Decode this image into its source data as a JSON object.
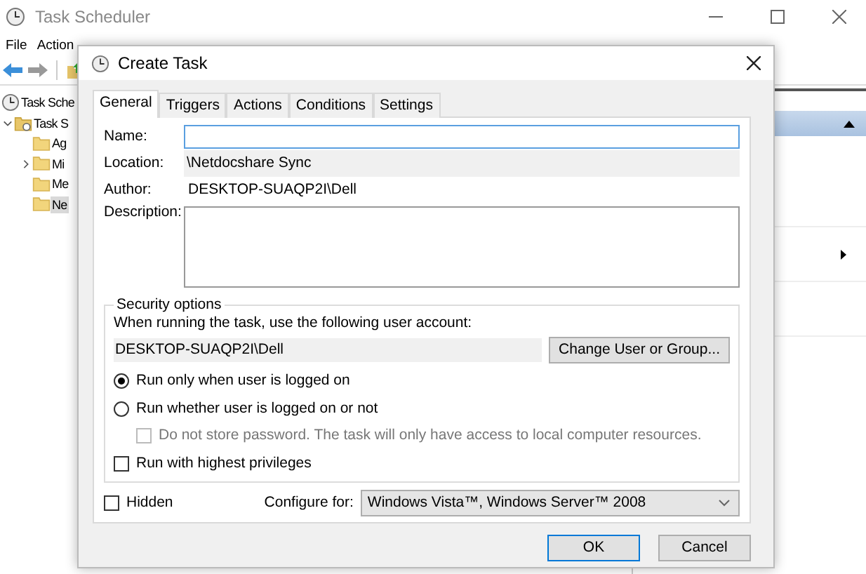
{
  "main_window": {
    "title": "Task Scheduler",
    "menu": [
      "File",
      "Action"
    ],
    "tree": [
      {
        "label": "Task Sche",
        "kind": "clock",
        "has_children": false,
        "selected": false,
        "children": [
          {
            "label": "Task S",
            "kind": "library",
            "has_children": true,
            "selected": false,
            "children": [
              {
                "label": "Ag",
                "kind": "folder",
                "has_children": false,
                "selected": false
              },
              {
                "label": "Mi",
                "kind": "folder",
                "has_children": true,
                "selected": false
              },
              {
                "label": "Me",
                "kind": "folder",
                "has_children": false,
                "selected": false
              },
              {
                "label": "Ne",
                "kind": "folder",
                "has_children": false,
                "selected": true
              }
            ]
          }
        ]
      }
    ]
  },
  "dialog": {
    "title": "Create Task",
    "tabs": [
      {
        "label": "General",
        "selected": true
      },
      {
        "label": "Triggers",
        "selected": false
      },
      {
        "label": "Actions",
        "selected": false
      },
      {
        "label": "Conditions",
        "selected": false
      },
      {
        "label": "Settings",
        "selected": false
      }
    ],
    "name": {
      "label": "Name:",
      "focused": true
    },
    "location": {
      "label": "Location:",
      "value": "\\Netdocshare Sync"
    },
    "author": {
      "label": "Author:",
      "value": "DESKTOP-SUAQP2I\\Dell"
    },
    "description": {
      "label": "Description:"
    },
    "security": {
      "title": "Security options",
      "prompt": "When running the task, use the following user account:",
      "account": "DESKTOP-SUAQP2I\\Dell",
      "change_button": "Change User or Group...",
      "options": [
        {
          "kind": "radio",
          "label": "Run only when user is logged on",
          "selected": true,
          "disabled": false,
          "indent": false
        },
        {
          "kind": "radio",
          "label": "Run whether user is logged on or not",
          "selected": false,
          "disabled": false,
          "indent": false
        },
        {
          "kind": "checkbox",
          "label": "Do not store password.  The task will only have access to local computer resources.",
          "checked": false,
          "disabled": true,
          "indent": true
        },
        {
          "kind": "checkbox",
          "label": "Run with highest privileges",
          "checked": false,
          "disabled": false,
          "indent": false
        }
      ]
    },
    "hidden": {
      "label": "Hidden",
      "checked": false
    },
    "configure": {
      "label": "Configure for:",
      "value": "Windows Vista™, Windows Server™ 2008"
    },
    "buttons": [
      {
        "label": "OK",
        "default": true
      },
      {
        "label": "Cancel",
        "default": false
      }
    ]
  }
}
